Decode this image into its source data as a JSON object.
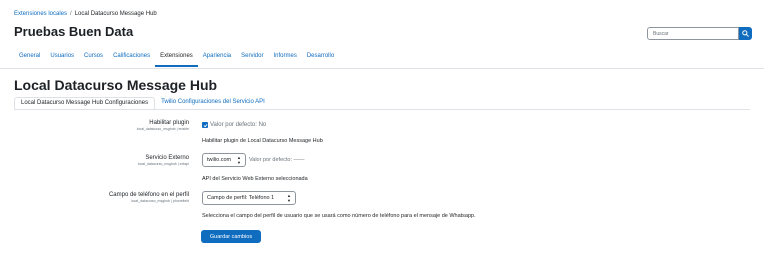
{
  "breadcrumb": {
    "items": [
      "Extensiones locales",
      "Local Datacurso Message Hub"
    ],
    "separator": "/"
  },
  "site_title": "Pruebas Buen Data",
  "search": {
    "placeholder": "Buscar",
    "icon": "search-icon"
  },
  "nav": {
    "items": [
      "General",
      "Usuarios",
      "Cursos",
      "Calificaciones",
      "Extensiones",
      "Apariencia",
      "Servidor",
      "Informes",
      "Desarrollo"
    ],
    "active": "Extensiones"
  },
  "page_heading": "Local Datacurso Message Hub",
  "tabs": [
    "Local Datacurso Message Hub Configuraciones",
    "Twilio Configuraciones del Servicio API"
  ],
  "settings": {
    "enable": {
      "label": "Habilitar plugin",
      "key": "local_datacurso_msghub | enable",
      "checked": true,
      "default_note": "Valor por defecto: No",
      "description": "Habilitar plugin de Local Datacurso Message Hub"
    },
    "service": {
      "label": "Servicio Externo",
      "key": "local_datacurso_msghub | extapi",
      "value": "twilio.com",
      "default_note": "Valor por defecto: ——",
      "description": "API del Servicio Web Externo seleccionada"
    },
    "phone": {
      "label": "Campo de teléfono en el perfil",
      "key": "local_datacurso_msghub | phonefield",
      "value": "Campo de perfil: Teléfono 1",
      "description": "Selecciona el campo del perfil de usuario que se usará como número de teléfono para el mensaje de Whatsapp."
    }
  },
  "save_label": "Guardar cambios",
  "colors": {
    "accent": "#0f6cbf",
    "text": "#1d2125",
    "muted": "#6a737b",
    "border": "#dee2e6"
  }
}
